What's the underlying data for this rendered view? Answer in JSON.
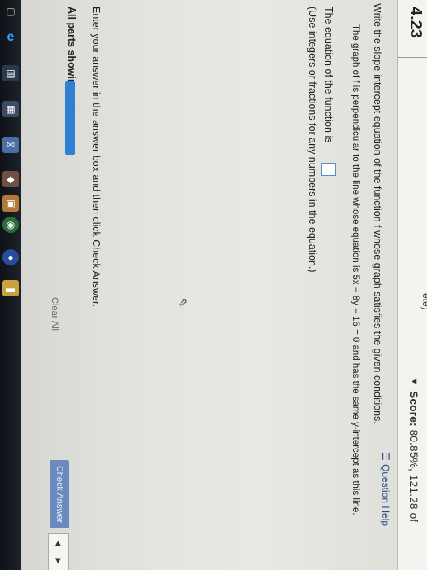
{
  "header": {
    "question_number": "4.23",
    "top_partial": "ete)",
    "score_label": "Score:",
    "score_value": "80.85%, 121.28 of",
    "help_label": "Question Help"
  },
  "question": {
    "instruction": "Write the slope-intercept equation of the function f whose graph satisfies the given conditions.",
    "condition": "The graph of f is perpendicular to the line whose equation is 5x − 8y − 16 = 0 and has the same y-intercept as this line.",
    "equation_prefix": "The equation of the function is",
    "answer_value": "",
    "hint": "(Use integers or fractions for any numbers in the equation.)"
  },
  "footer": {
    "enter_text": "Enter your answer in the answer box and then click Check Answer.",
    "all_parts": "All parts showing",
    "clear_all": "Clear All",
    "check_answer": "Check Answer"
  },
  "taskbar": {
    "icons": [
      "edge-icon",
      "file-explorer-icon",
      "store-icon",
      "mail-icon",
      "app-icon",
      "photos-icon",
      "chrome-icon",
      "firefox-icon",
      "folder-icon"
    ]
  }
}
